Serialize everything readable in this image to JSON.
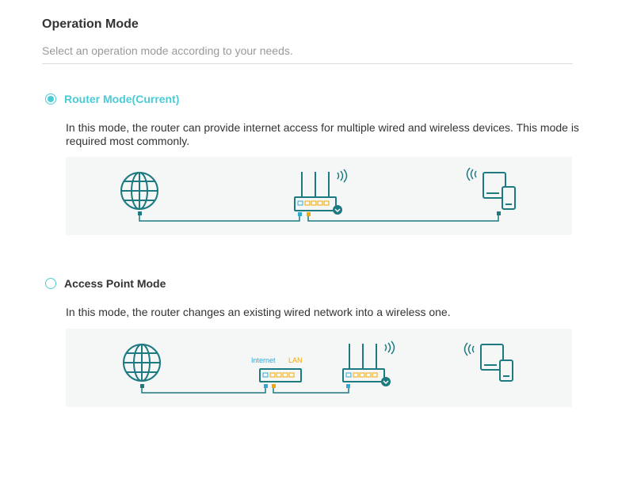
{
  "header": {
    "title": "Operation Mode",
    "subtitle": "Select an operation mode according to your needs."
  },
  "modes": [
    {
      "label": "Router Mode(Current)",
      "selected": true,
      "description": "In this mode, the router can provide internet access for multiple wired and wireless devices. This mode is required most commonly."
    },
    {
      "label": "Access Point Mode",
      "selected": false,
      "description": "In this mode, the router changes an existing wired network into a wireless one.",
      "diagram_labels": {
        "internet": "Internet",
        "lan": "LAN"
      }
    }
  ],
  "colors": {
    "accent": "#4acbd6",
    "icon": "#1d7a80",
    "internet_port": "#2fa9d5",
    "lan_port": "#f2a900",
    "panel_bg": "#f5f6f6"
  }
}
